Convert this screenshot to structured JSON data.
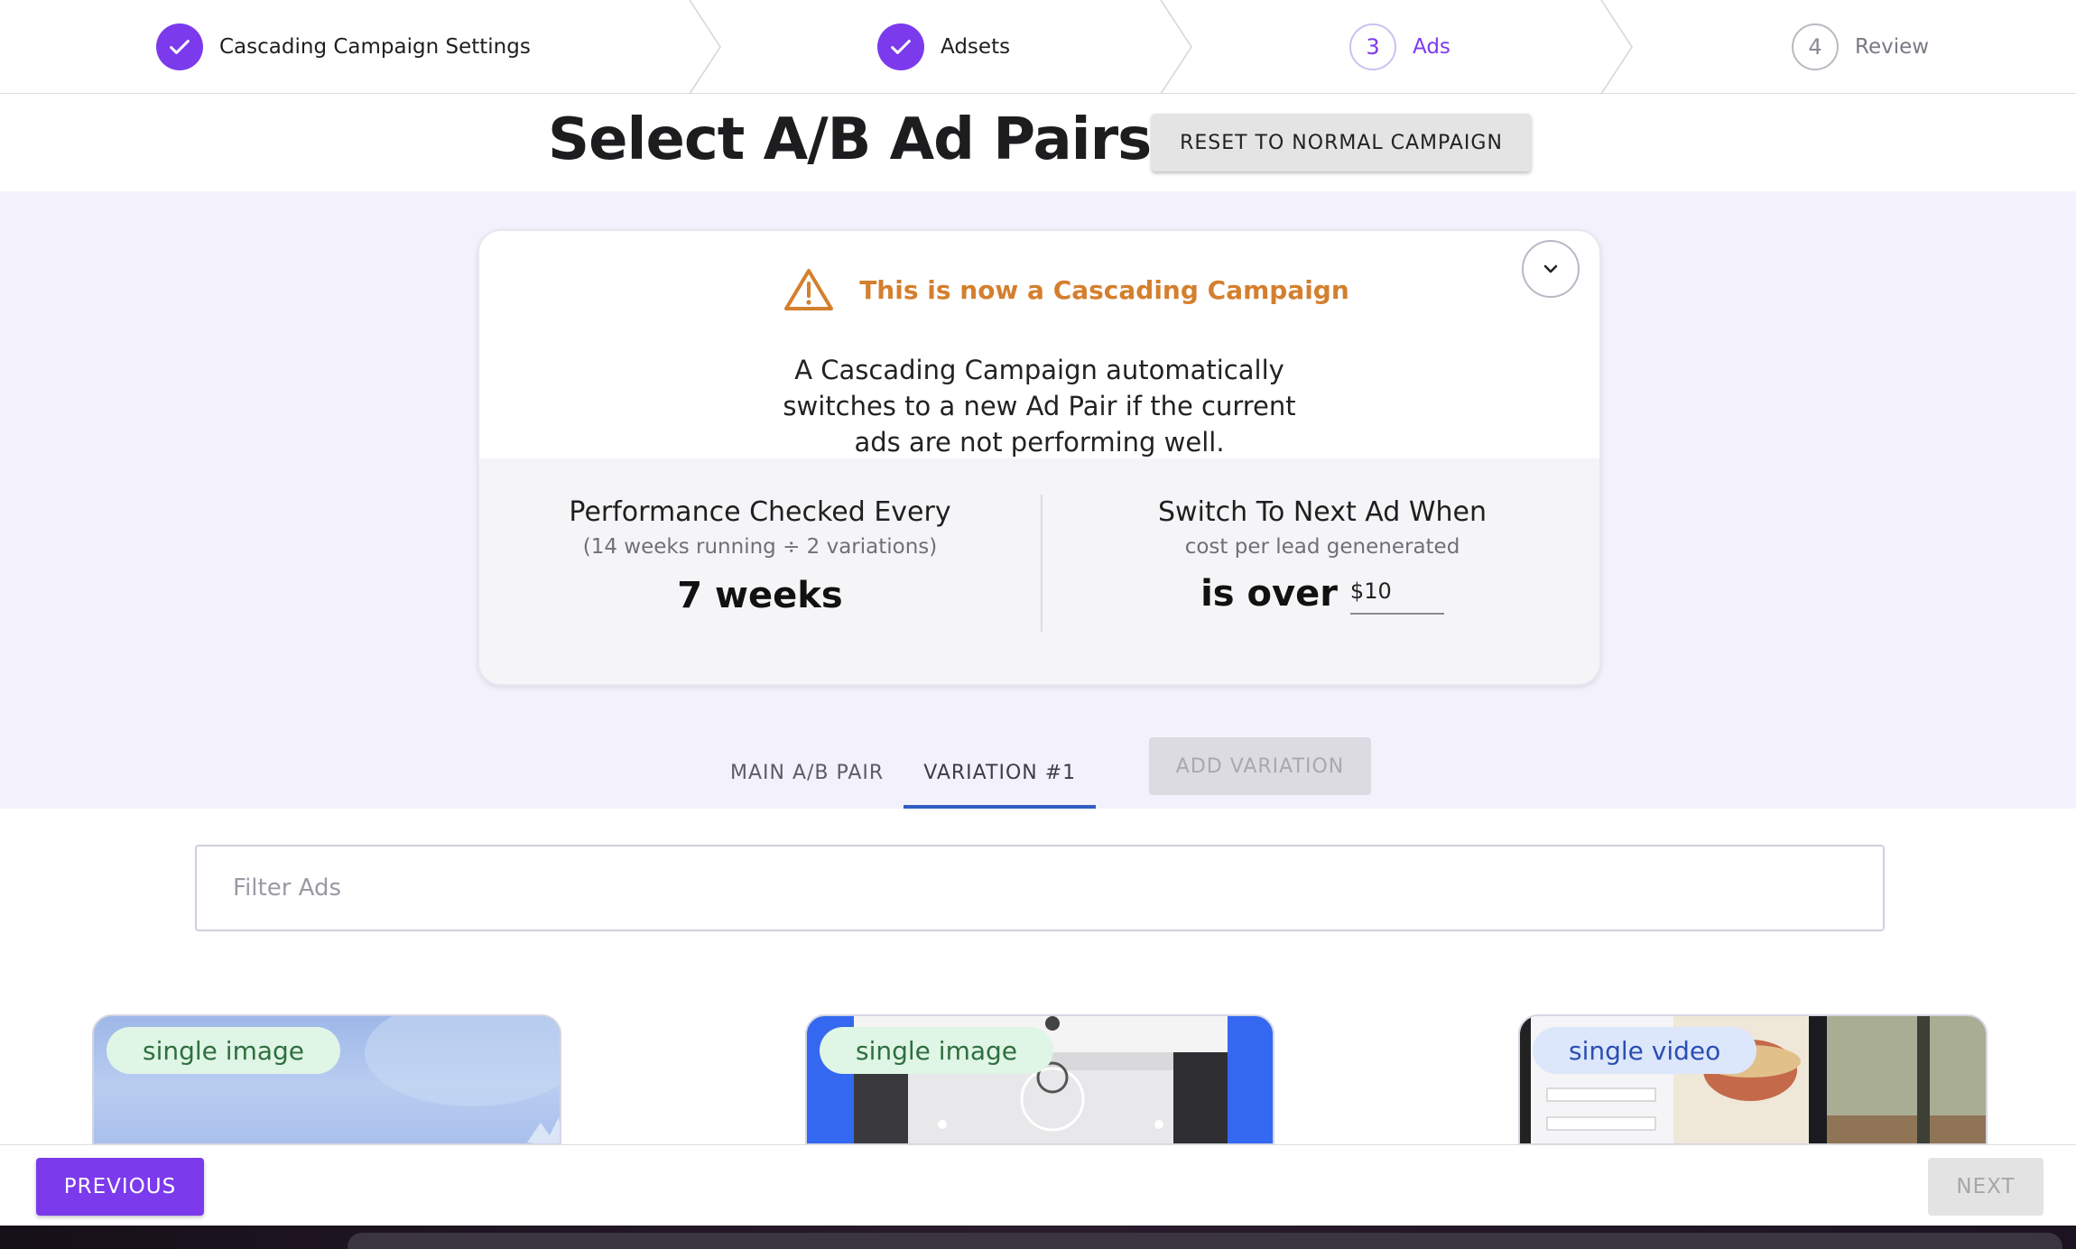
{
  "stepper": {
    "steps": [
      {
        "label": "Cascading Campaign Settings",
        "state": "complete"
      },
      {
        "label": "Adsets",
        "state": "complete"
      },
      {
        "number": "3",
        "label": "Ads",
        "state": "active"
      },
      {
        "number": "4",
        "label": "Review",
        "state": "pending"
      }
    ]
  },
  "page": {
    "title": "Select A/B Ad Pairs",
    "reset_button": "RESET TO NORMAL CAMPAIGN"
  },
  "cascade_card": {
    "warning_title": "This is now a Cascading Campaign",
    "description": "A Cascading Campaign automatically switches to a new Ad Pair if the current ads are not performing well.",
    "performance": {
      "heading": "Performance Checked Every",
      "subheading": "(14 weeks running ÷ 2 variations)",
      "value": "7 weeks"
    },
    "switch": {
      "heading": "Switch To Next Ad When",
      "subheading": "cost per lead genenerated",
      "label": "is over",
      "threshold": "$10"
    }
  },
  "tabs": {
    "items": [
      "MAIN A/B PAIR",
      "VARIATION #1"
    ],
    "selected": "VARIATION #1",
    "add_button": "ADD VARIATION"
  },
  "filter": {
    "placeholder": "Filter Ads",
    "value": ""
  },
  "ads": [
    {
      "badge": "single image"
    },
    {
      "badge": "single image"
    },
    {
      "badge": "single video"
    }
  ],
  "footer": {
    "previous": "PREVIOUS",
    "next": "NEXT"
  },
  "colors": {
    "accent": "#7c3aed",
    "warning": "#d47f2e",
    "band_bg": "#f3f2fc",
    "tab_underline": "#2f5fc4"
  }
}
